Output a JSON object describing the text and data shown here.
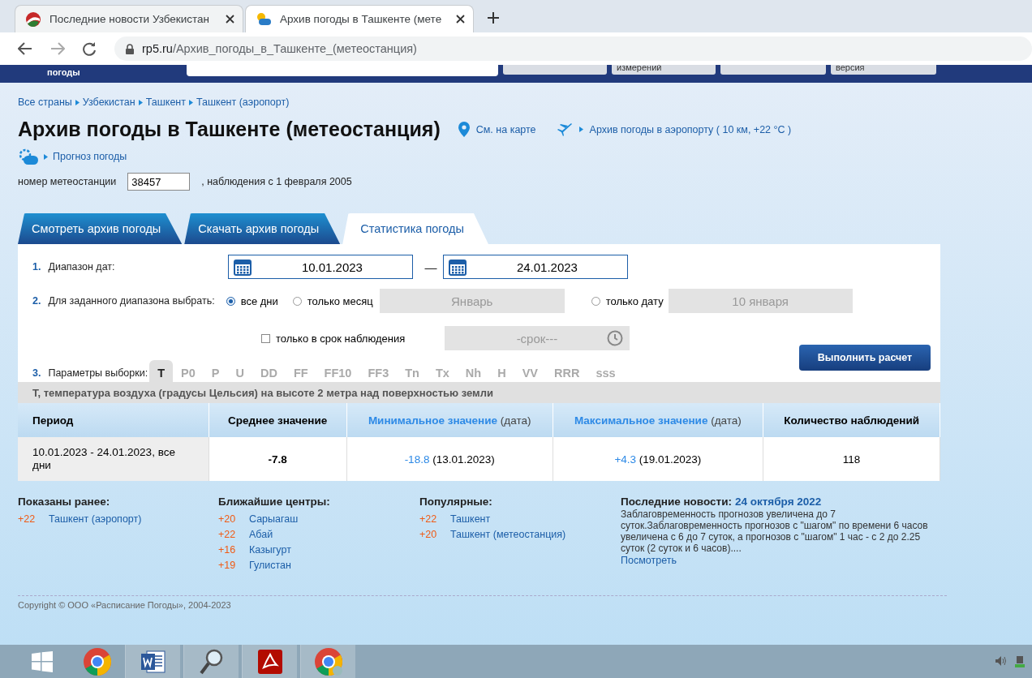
{
  "browser": {
    "tabs": [
      {
        "title": "Последние новости Узбекистан",
        "kind": "flag",
        "selected": false
      },
      {
        "title": "Архив погоды в Ташкенте (мете",
        "kind": "rp5",
        "selected": true
      }
    ],
    "address": {
      "domain": "rp5.ru",
      "path": "/Архив_погоды_в_Ташкенте_(метеостанция)"
    }
  },
  "site_header": {
    "logo_text": "погоды",
    "button_1": "измерений",
    "button_2": "версия"
  },
  "breadcrumbs": [
    "Все страны",
    "Узбекистан",
    "Ташкент",
    "Ташкент (аэропорт)"
  ],
  "title": "Архив погоды в Ташкенте (метеостанция)",
  "map_link": "См. на карте",
  "airport_link": "Архив погоды в аэропорту ( 10 км, +22 °C )",
  "forecast_link": "Прогноз погоды",
  "station": {
    "label": "номер метеостанции",
    "value": "38457",
    "note": ", наблюдения с 1 февраля 2005"
  },
  "page_tabs": [
    {
      "label": "Смотреть архив погоды",
      "selected": false
    },
    {
      "label": "Скачать архив погоды",
      "selected": false
    },
    {
      "label": "Статистика погоды",
      "selected": true
    }
  ],
  "form": {
    "date_range": {
      "number": "1.",
      "label": "Диапазон дат:",
      "from": "10.01.2023",
      "separator": "—",
      "to": "24.01.2023"
    },
    "choose": {
      "number": "2.",
      "label": "Для заданного диапазона выбрать:",
      "options": [
        {
          "label": "все дни",
          "selected": true
        },
        {
          "label": "только месяц",
          "selected": false,
          "placeholder": "Январь"
        },
        {
          "label": "только дату",
          "selected": false,
          "placeholder": "10 января"
        }
      ]
    },
    "term": {
      "label": "только в срок наблюдения",
      "checked": false,
      "placeholder": "-срок---"
    },
    "params": {
      "number": "3.",
      "label": "Параметры выборки:",
      "items": [
        {
          "label": "T",
          "selected": true
        },
        {
          "label": "P0",
          "selected": false
        },
        {
          "label": "P",
          "selected": false
        },
        {
          "label": "U",
          "selected": false
        },
        {
          "label": "DD",
          "selected": false
        },
        {
          "label": "FF",
          "selected": false
        },
        {
          "label": "FF10",
          "selected": false
        },
        {
          "label": "FF3",
          "selected": false
        },
        {
          "label": "Tn",
          "selected": false
        },
        {
          "label": "Tx",
          "selected": false
        },
        {
          "label": "Nh",
          "selected": false
        },
        {
          "label": "H",
          "selected": false
        },
        {
          "label": "VV",
          "selected": false
        },
        {
          "label": "RRR",
          "selected": false
        },
        {
          "label": "sss",
          "selected": false
        }
      ]
    },
    "button": "Выполнить расчет"
  },
  "table": {
    "caption": "T, температура воздуха (градусы Цельсия) на высоте 2 метра над поверхностью земли",
    "columns": [
      {
        "label": "Период",
        "kind": "plain"
      },
      {
        "label": "Среднее значение",
        "kind": "plain"
      },
      {
        "label": "Минимальное значение",
        "suffix": "(дата)",
        "kind": "link"
      },
      {
        "label": "Максимальное значение",
        "suffix": "(дата)",
        "kind": "link"
      },
      {
        "label": "Количество наблюдений",
        "kind": "plain"
      }
    ],
    "rows": [
      {
        "cells": [
          {
            "kind": "period",
            "text": "10.01.2023 - 24.01.2023, все дни"
          },
          {
            "kind": "bold",
            "text": "-7.8"
          },
          {
            "kind": "link",
            "text": "-18.8",
            "suffix": "(13.01.2023)"
          },
          {
            "kind": "link",
            "text": "+4.3",
            "suffix": "(19.01.2023)"
          },
          {
            "kind": "plain",
            "text": "118"
          }
        ]
      }
    ]
  },
  "footer": {
    "lists": [
      {
        "title": "Показаны ранее:",
        "items": [
          {
            "temp": "+22",
            "place": "Ташкент (аэропорт)"
          }
        ]
      },
      {
        "title": "Ближайшие центры:",
        "items": [
          {
            "temp": "+20",
            "place": "Сарыагаш"
          },
          {
            "temp": "+22",
            "place": "Абай"
          },
          {
            "temp": "+16",
            "place": "Казыгурт"
          },
          {
            "temp": "+19",
            "place": "Гулистан"
          }
        ]
      },
      {
        "title": "Популярные:",
        "items": [
          {
            "temp": "+22",
            "place": "Ташкент"
          },
          {
            "temp": "+20",
            "place": "Ташкент (метеостанция)"
          }
        ]
      }
    ],
    "news": {
      "title": "Последние новости:",
      "date": "24 октября 2022",
      "text": "Заблаговременность прогнозов увеличена до 7 суток.Заблаговременность прогнозов с \"шагом\" по времени 6 часов увеличена с 6 до 7 суток, а прогнозов с \"шагом\" 1 час - с 2 до 2.25 суток (2 суток и 6 часов)....",
      "more": "Посмотреть"
    },
    "copyright": "Copyright © ООО «Расписание Погоды», 2004-2023"
  },
  "taskbar": {
    "apps": [
      {
        "kind": "windows",
        "selected": false
      },
      {
        "kind": "chrome",
        "selected": false
      },
      {
        "kind": "word",
        "selected": true
      },
      {
        "kind": "search",
        "selected": true
      },
      {
        "kind": "pdf",
        "selected": true
      },
      {
        "kind": "chrome-user",
        "selected": true
      }
    ]
  }
}
